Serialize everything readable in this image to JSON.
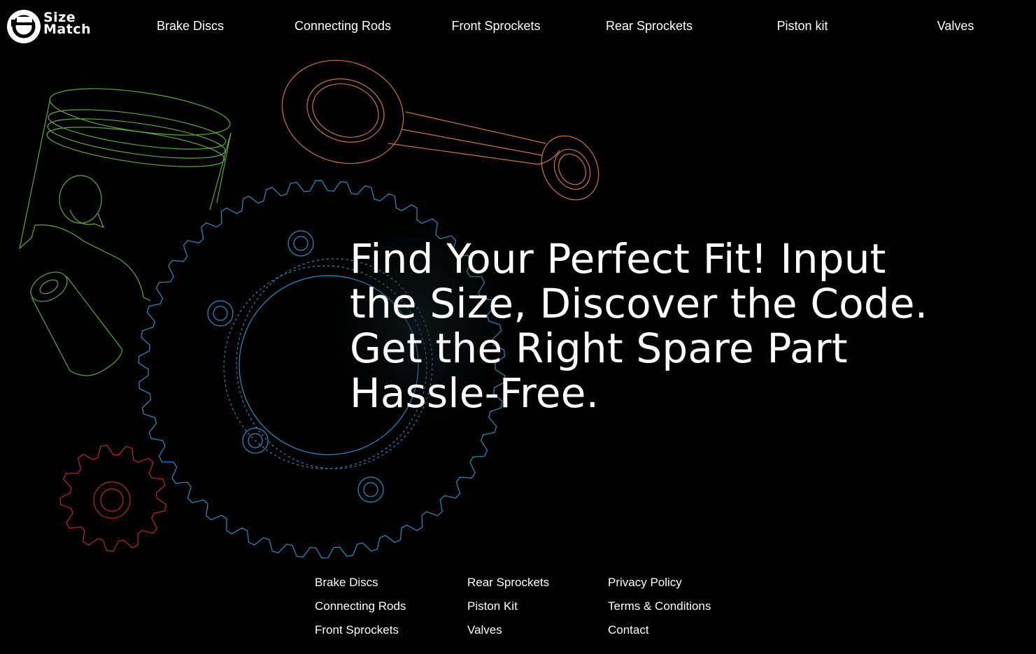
{
  "brand": {
    "logo_line1": "Size",
    "logo_line2": "Match"
  },
  "nav": {
    "items": [
      {
        "label": "Brake Discs"
      },
      {
        "label": "Connecting Rods"
      },
      {
        "label": "Front Sprockets"
      },
      {
        "label": "Rear Sprockets"
      },
      {
        "label": "Piston kit"
      },
      {
        "label": "Valves"
      }
    ]
  },
  "hero": {
    "line1": "Find Your Perfect Fit! Input",
    "line2": "the Size, Discover the Code.",
    "line3": "Get the Right Spare Part",
    "line4": "Hassle-Free."
  },
  "illustration": {
    "piston_color": "#5fa845",
    "rod_color": "#c8784a",
    "rear_sprocket_color": "#2f8ec0",
    "front_sprocket_color": "#c0262a"
  },
  "footer": {
    "col1": [
      "Brake Discs",
      "Connecting Rods",
      "Front Sprockets"
    ],
    "col2": [
      "Rear Sprockets",
      "Piston Kit",
      "Valves"
    ],
    "col3": [
      "Privacy Policy",
      "Terms & Conditions",
      "Contact"
    ]
  }
}
